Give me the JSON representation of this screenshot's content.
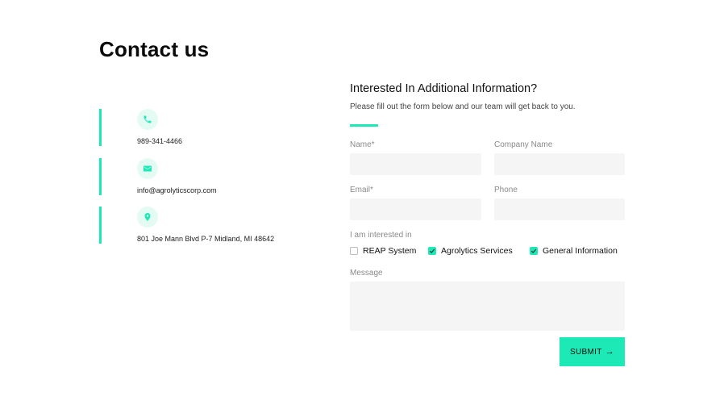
{
  "page": {
    "title": "Contact us"
  },
  "contacts": [
    {
      "icon": "phone-icon",
      "value": "989-341-4466"
    },
    {
      "icon": "mail-icon",
      "value": "info@agrolyticscorp.com"
    },
    {
      "icon": "location-pin-icon",
      "value": "801 Joe Mann Blvd P-7 Midland, MI 48642"
    }
  ],
  "form": {
    "heading": "Interested In Additional Information?",
    "subtitle": "Please fill out the form below and our team will get back to you.",
    "name_label": "Name*",
    "name_value": "",
    "company_label": "Company Name",
    "company_value": "",
    "email_label": "Email*",
    "email_value": "",
    "phone_label": "Phone",
    "phone_value": "",
    "interest_label": "I am interested in",
    "options": [
      {
        "label": "REAP System",
        "checked": false
      },
      {
        "label": "Agrolytics Services",
        "checked": true
      },
      {
        "label": "General Information",
        "checked": true
      }
    ],
    "message_label": "Message",
    "message_value": "",
    "submit_label": "SUBMIT",
    "submit_arrow": "→"
  },
  "colors": {
    "accent": "#1de9b6",
    "input_bg": "#f5f5f5",
    "icon_bg": "#e4fbf4"
  }
}
